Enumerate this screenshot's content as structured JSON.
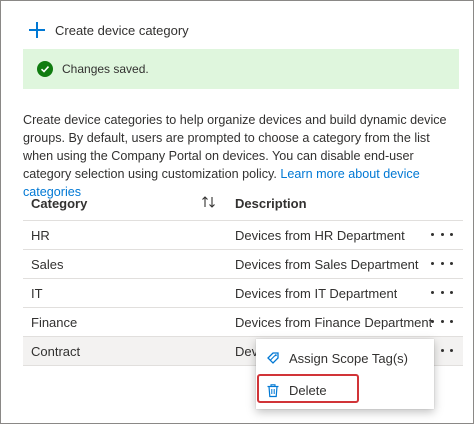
{
  "commands": {
    "create_label": "Create device category",
    "create_icon": "plus-icon"
  },
  "banner": {
    "text": "Changes saved.",
    "icon": "check-circle-icon",
    "color": "#107c10"
  },
  "description": {
    "text": "Create device categories to help organize devices and build dynamic device groups. By default, users are prompted to choose a category from the list when using the Company Portal on devices. You can disable end-user category selection using customization policy.",
    "link": "Learn more about device categories"
  },
  "table": {
    "columns": {
      "category": "Category",
      "description": "Description"
    },
    "rows": [
      {
        "category": "HR",
        "description": "Devices from HR Department"
      },
      {
        "category": "Sales",
        "description": "Devices from Sales Department"
      },
      {
        "category": "IT",
        "description": "Devices from IT Department"
      },
      {
        "category": "Finance",
        "description": "Devices from Finance Department"
      },
      {
        "category": "Contract",
        "description": "Devi"
      }
    ]
  },
  "context_menu": {
    "items": [
      {
        "label": "Assign Scope Tag(s)",
        "icon": "scope-tag-icon"
      },
      {
        "label": "Delete",
        "icon": "trash-icon"
      }
    ]
  },
  "colors": {
    "accent": "#0078d4",
    "success_bg": "#dff6dd",
    "highlight": "#d13438"
  }
}
